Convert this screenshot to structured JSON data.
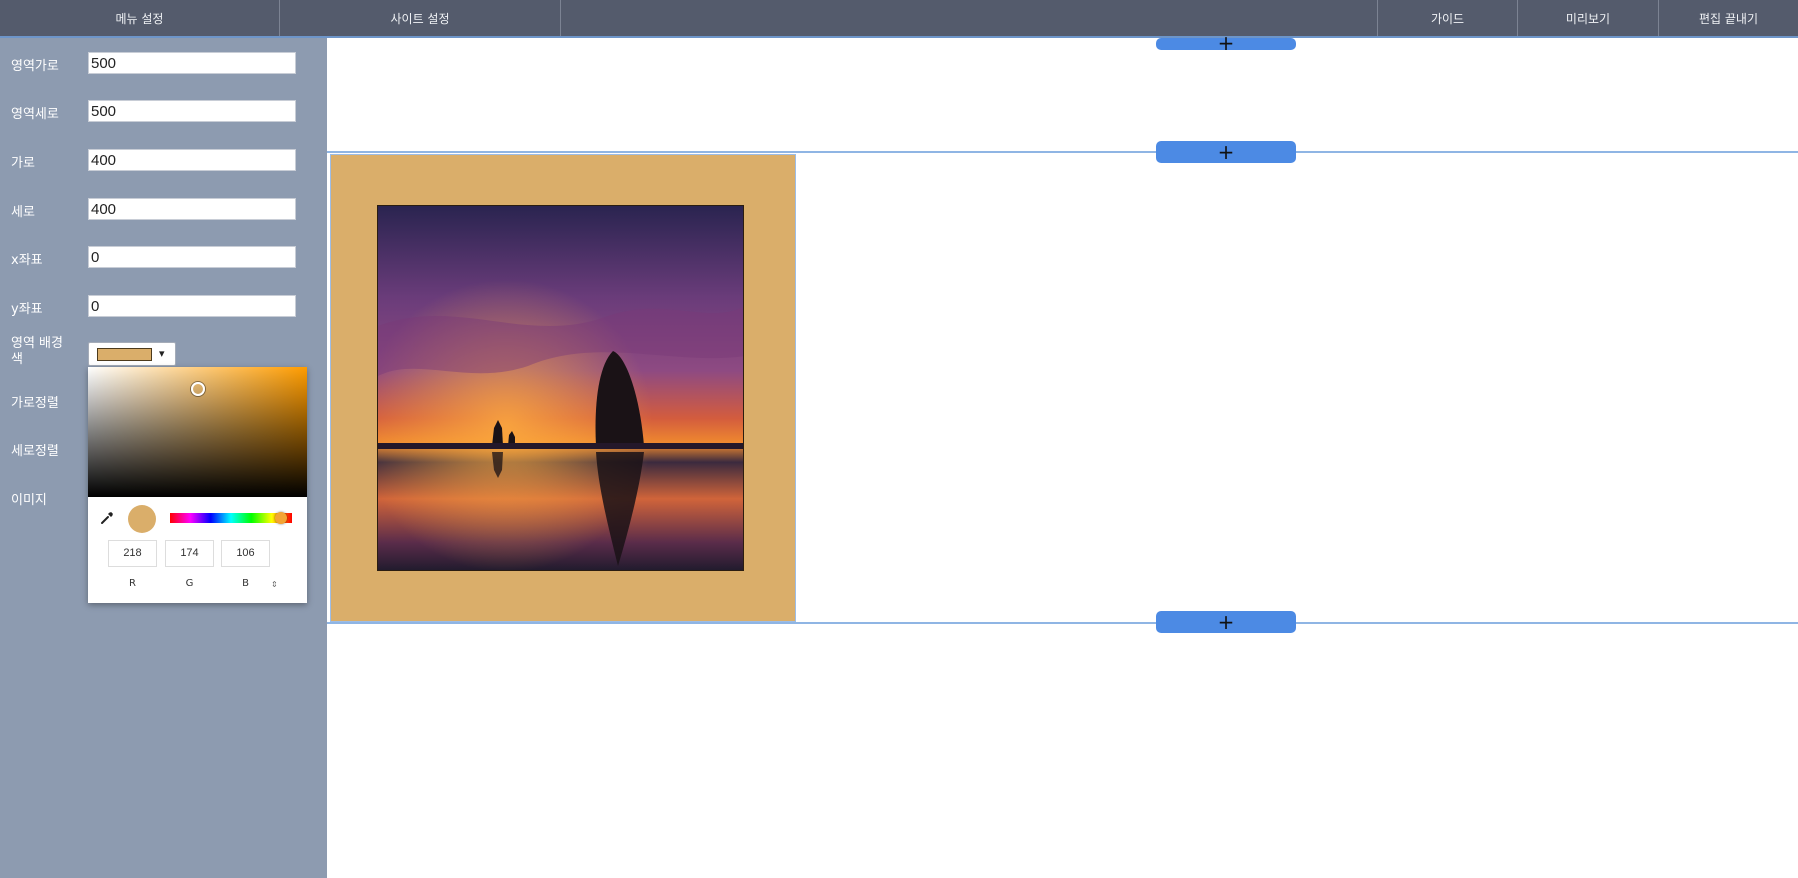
{
  "topbar": {
    "menu_settings": "메뉴 설정",
    "site_settings": "사이트 설정",
    "guide": "가이드",
    "preview": "미리보기",
    "finish_edit": "편집 끝내기"
  },
  "sidebar": {
    "fields": [
      {
        "label": "영역가로",
        "value": "500"
      },
      {
        "label": "영역세로",
        "value": "500"
      },
      {
        "label": "가로",
        "value": "400"
      },
      {
        "label": "세로",
        "value": "400"
      },
      {
        "label": "x좌표",
        "value": "0"
      },
      {
        "label": "y좌표",
        "value": "0"
      }
    ],
    "bg_color_label_line1": "영역 배경",
    "bg_color_label_line2": "색",
    "h_align_label": "가로정렬",
    "v_align_label": "세로정렬",
    "image_label": "이미지"
  },
  "color_picker": {
    "selected_color": "#daae6a",
    "r": "218",
    "g": "174",
    "b": "106",
    "r_label": "R",
    "g_label": "G",
    "b_label": "B",
    "toggle_symbol": "⇕"
  },
  "canvas": {
    "add_symbol": "+",
    "area_background": "#daae6a"
  },
  "icons": {
    "dropdown": "chevron-down-icon",
    "eyedropper": "eyedropper-icon",
    "add": "plus-icon"
  },
  "colors": {
    "topbar": "#545b6c",
    "sidebar": "#8d9bb0",
    "accent": "#4c8ae4"
  }
}
